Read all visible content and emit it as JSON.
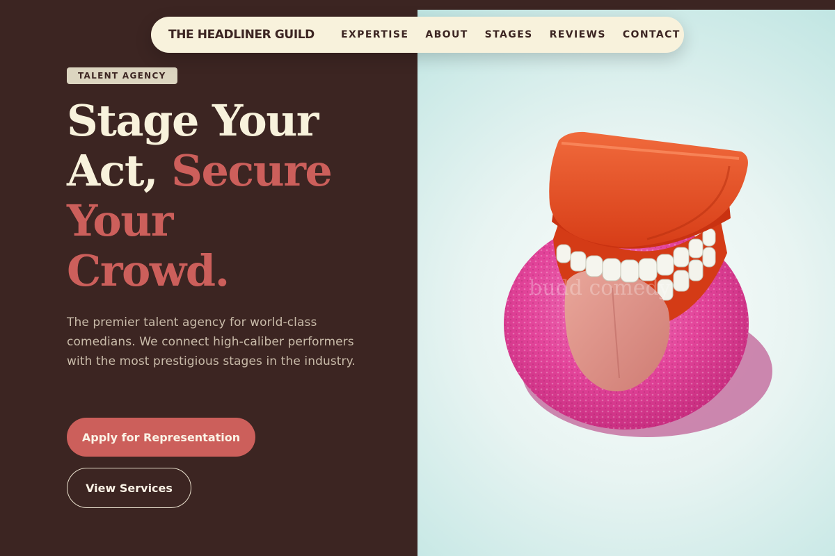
{
  "nav": {
    "brand": "THE HEADLINER GUILD",
    "links": [
      {
        "label": "EXPERTISE"
      },
      {
        "label": "ABOUT"
      },
      {
        "label": "STAGES"
      },
      {
        "label": "REVIEWS"
      },
      {
        "label": "CONTACT"
      }
    ]
  },
  "hero": {
    "badge": "TALENT AGENCY",
    "headline": {
      "line1": "Stage Your",
      "line2_plain": "Act, ",
      "line2_accent": "Secure",
      "line3": "Your",
      "line4": "Crowd."
    },
    "description": "The premier talent agency for world-class comedians. We connect high-caliber performers with the most prestigious stages in the industry.",
    "primary_cta": "Apply for Representation",
    "secondary_cta": "View Services"
  },
  "image": {
    "subject": "wind-up chattering teeth toy with tongue on pink sponge",
    "watermark": "budd comedy"
  },
  "colors": {
    "background": "#3c2522",
    "cream": "#f8f2dc",
    "accent": "#cc5f5b",
    "body_text": "#c9bba9",
    "badge_bg": "#dcd5c0"
  }
}
